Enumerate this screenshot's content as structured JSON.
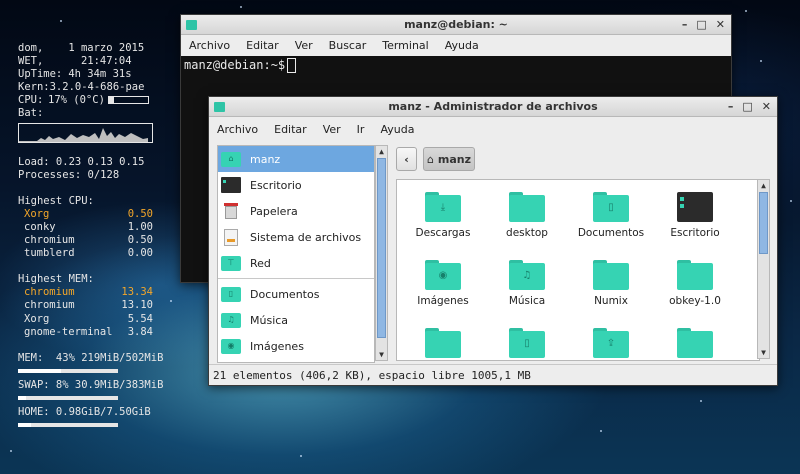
{
  "conky": {
    "rows": [
      {
        "k": "dom,",
        "v": " 1 marzo 2015"
      },
      {
        "k": "WET,",
        "v": "   21:47:04"
      },
      {
        "k": "UpTime:",
        "v": " 4h 34m 31s"
      },
      {
        "k": "Kern:",
        "v": "3.2.0-4-686-pae"
      },
      {
        "k": "CPU:",
        "v": "17% (0°C)"
      },
      {
        "k": "Bat:",
        "v": ""
      }
    ],
    "cpu_bar_fraction": 0.12,
    "load": "Load: 0.23 0.13 0.15",
    "processes": "Processes: 0/128",
    "cpu_title": "Highest CPU:",
    "cpu_procs": [
      {
        "name": "Xorg",
        "val": "0.50"
      },
      {
        "name": "conky",
        "val": "1.00"
      },
      {
        "name": "chromium",
        "val": "0.50"
      },
      {
        "name": "tumblerd",
        "val": "0.00"
      }
    ],
    "mem_title": "Highest MEM:",
    "mem_procs": [
      {
        "name": "chromium",
        "val": "13.34"
      },
      {
        "name": "chromium",
        "val": "13.10"
      },
      {
        "name": "Xorg",
        "val": "5.54"
      },
      {
        "name": "gnome-terminal",
        "val": "3.84"
      }
    ],
    "mem": "MEM:  43% 219MiB/502MiB",
    "mem_fraction": 0.43,
    "swap": "SWAP: 8% 30.9MiB/383MiB",
    "swap_fraction": 0.08,
    "home": "HOME: 0.98GiB/7.50GiB",
    "home_fraction": 0.13
  },
  "terminal": {
    "title": "manz@debian: ~",
    "menu": [
      "Archivo",
      "Editar",
      "Ver",
      "Buscar",
      "Terminal",
      "Ayuda"
    ],
    "prompt": "manz@debian:~$"
  },
  "filemanager": {
    "title": "manz - Administrador de archivos",
    "menu": [
      "Archivo",
      "Editar",
      "Ver",
      "Ir",
      "Ayuda"
    ],
    "places": [
      {
        "label": "manz",
        "icon": "home-folder-icon",
        "selected": true
      },
      {
        "label": "Escritorio",
        "icon": "desktop-icon"
      },
      {
        "label": "Papelera",
        "icon": "trash-icon"
      },
      {
        "label": "Sistema de archivos",
        "icon": "drive-icon"
      },
      {
        "label": "Red",
        "icon": "network-folder-icon"
      },
      {
        "label": "Documentos",
        "icon": "documents-folder-icon"
      },
      {
        "label": "Música",
        "icon": "music-folder-icon"
      },
      {
        "label": "Imágenes",
        "icon": "pictures-folder-icon"
      }
    ],
    "path_button": "manz",
    "items": [
      {
        "label": "Descargas",
        "icon": "download-folder-icon"
      },
      {
        "label": "desktop",
        "icon": "folder-icon"
      },
      {
        "label": "Documentos",
        "icon": "documents-folder-icon"
      },
      {
        "label": "Escritorio",
        "icon": "desktop-icon"
      },
      {
        "label": "Imágenes",
        "icon": "pictures-folder-icon"
      },
      {
        "label": "Música",
        "icon": "music-folder-icon"
      },
      {
        "label": "Numix",
        "icon": "folder-icon"
      },
      {
        "label": "obkey-1.0",
        "icon": "folder-icon"
      },
      {
        "label": "",
        "icon": "folder-icon"
      },
      {
        "label": "",
        "icon": "documents-folder-icon"
      },
      {
        "label": "",
        "icon": "upload-folder-icon"
      },
      {
        "label": "",
        "icon": "folder-icon"
      }
    ],
    "status": "21 elementos (406,2 KB), espacio libre 1005,1 MB"
  },
  "colors": {
    "accent": "#36d3b3",
    "highlight": "#f2a62a",
    "selection": "#6da7e0"
  }
}
